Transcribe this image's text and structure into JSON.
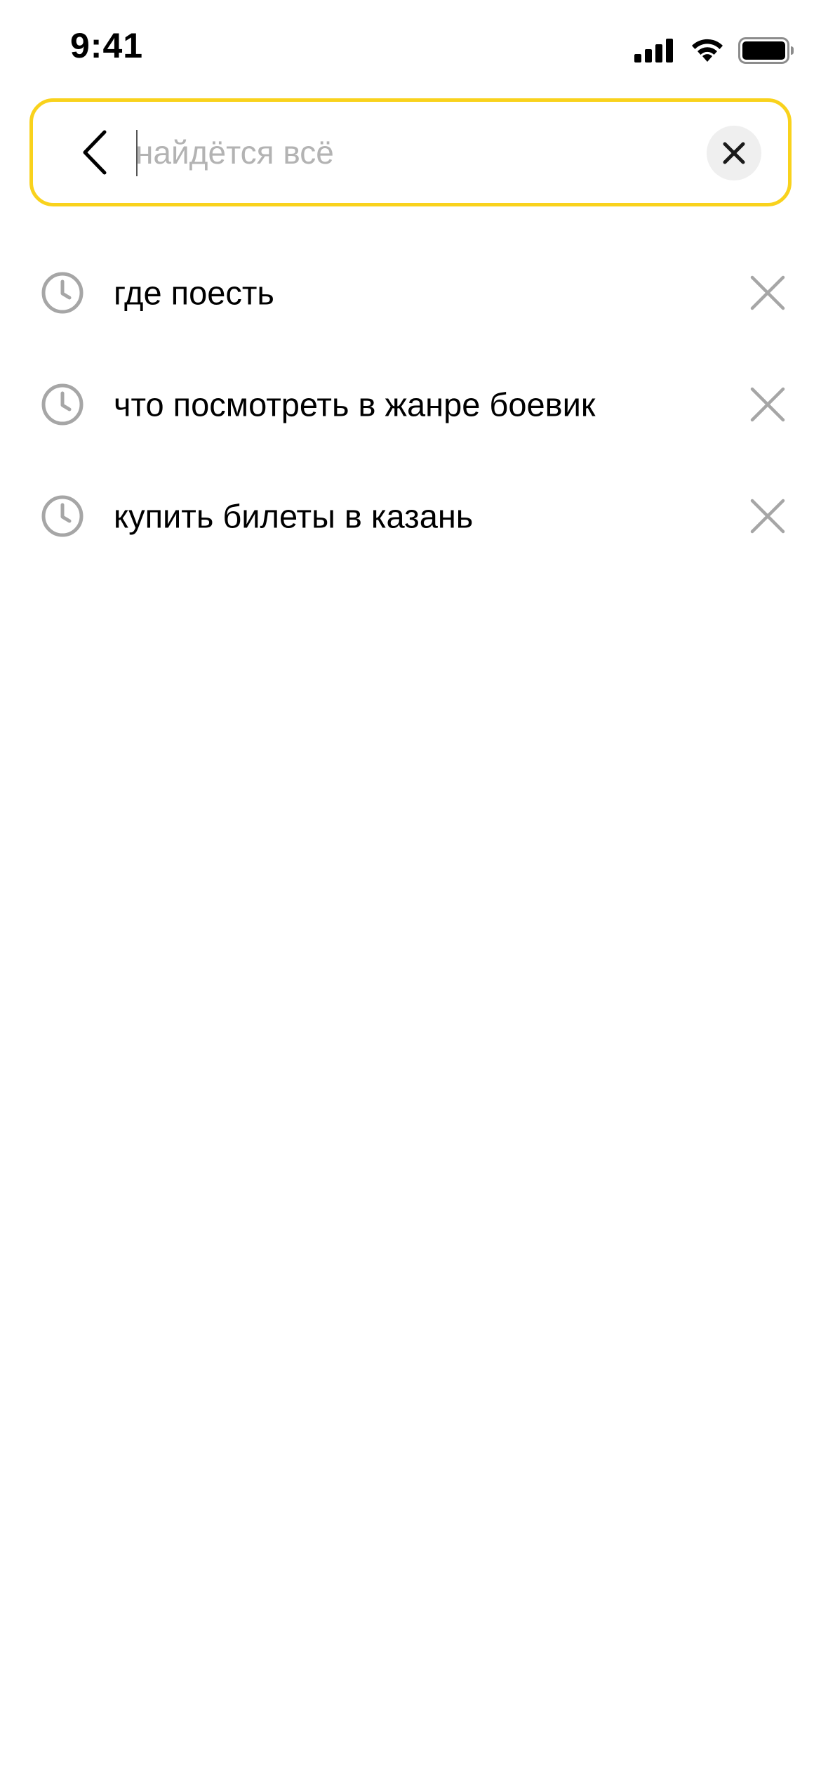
{
  "status_bar": {
    "time": "9:41"
  },
  "search": {
    "value": "",
    "placeholder": "найдётся всё"
  },
  "history": [
    {
      "text": "где поесть",
      "icon": "clock-icon",
      "remove_icon": "close-icon"
    },
    {
      "text": "что посмотреть в жанре боевик",
      "icon": "clock-icon",
      "remove_icon": "close-icon"
    },
    {
      "text": "купить билеты в казань",
      "icon": "clock-icon",
      "remove_icon": "close-icon"
    }
  ],
  "colors": {
    "search_border": "#f9d21c",
    "placeholder": "#b3b3b3",
    "icon_gray": "#a6a6a6",
    "clear_bg": "#efefef"
  }
}
